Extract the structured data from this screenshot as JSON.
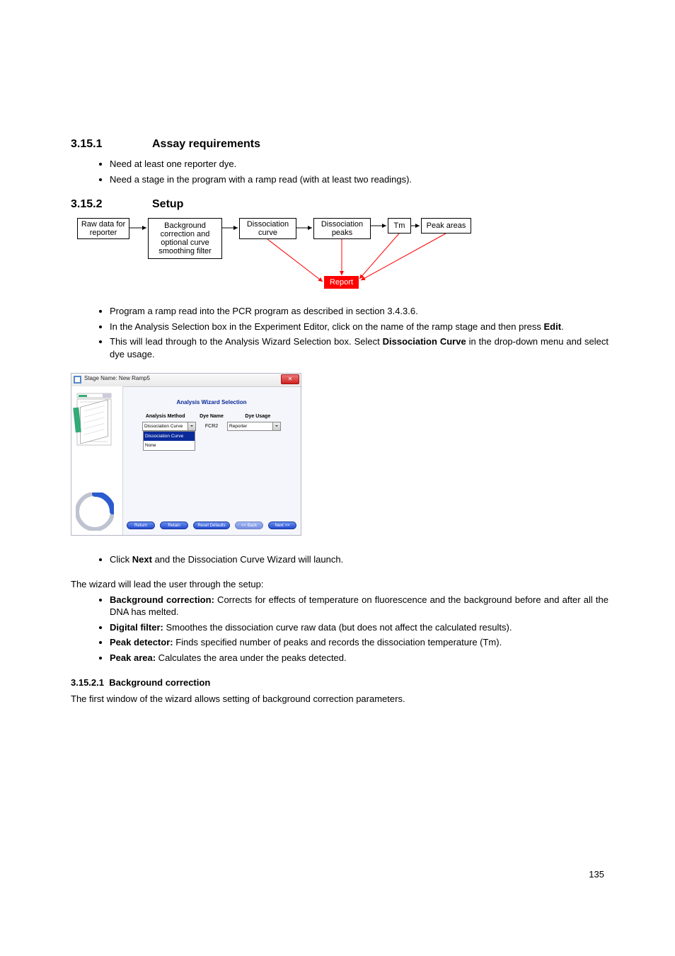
{
  "headings": {
    "s1_num": "3.15.1",
    "s1_title": "Assay requirements",
    "s2_num": "3.15.2",
    "s2_title": "Setup",
    "s3_num": "3.15.2.1",
    "s3_title": "Background correction"
  },
  "assay_reqs": [
    "Need at least one reporter dye.",
    "Need a stage in the program with a ramp read (with at least two readings)."
  ],
  "flow": {
    "b1": "Raw data for reporter",
    "b2": "Background correction and optional curve smoothing filter",
    "b3": "Dissociation curve",
    "b4": "Dissociation peaks",
    "b5": "Tm",
    "b6": "Peak areas",
    "b7": "Report"
  },
  "setup_steps": [
    "Program a ramp read into the PCR program as described in section 3.4.3.6.",
    "In the Analysis Selection box in the Experiment Editor, click on the name of the ramp stage and then press <b>Edit</b>.",
    "This will lead through to the Analysis Wizard Selection box. Select <b>Dissociation Curve</b> in the drop-down menu and select dye usage."
  ],
  "wizard": {
    "title": "Stage Name: New Ramp5",
    "header": "Analysis Wizard Selection",
    "col1": "Analysis Method",
    "col2": "Dye Name",
    "col3": "Dye Usage",
    "method_val": "Dissociation Curve",
    "method_opts": [
      "Dissociation Curve",
      "None"
    ],
    "dye_name": "FCR2",
    "dye_usage": "Reporter",
    "btns": [
      "Return",
      "Retain",
      "Reset Defaults",
      "<< Back",
      "Next >>"
    ]
  },
  "after_wizard_step": "Click <b>Next</b> and the Dissociation Curve Wizard will launch.",
  "lead_para": "The wizard will lead the user through the setup:",
  "wizard_steps": [
    "<b>Background correction:</b> Corrects for effects of temperature on fluorescence and the background before and after all the DNA has melted.",
    "<b>Digital filter:</b> Smoothes the dissociation curve raw data (but does not affect the calculated results).",
    "<b>Peak detector:</b> Finds specified number of peaks and records the dissociation temperature (Tm).",
    "<b>Peak area:</b> Calculates the area under the peaks detected."
  ],
  "bc_para": "The first window of the wizard allows setting of background correction parameters.",
  "page_number": "135"
}
